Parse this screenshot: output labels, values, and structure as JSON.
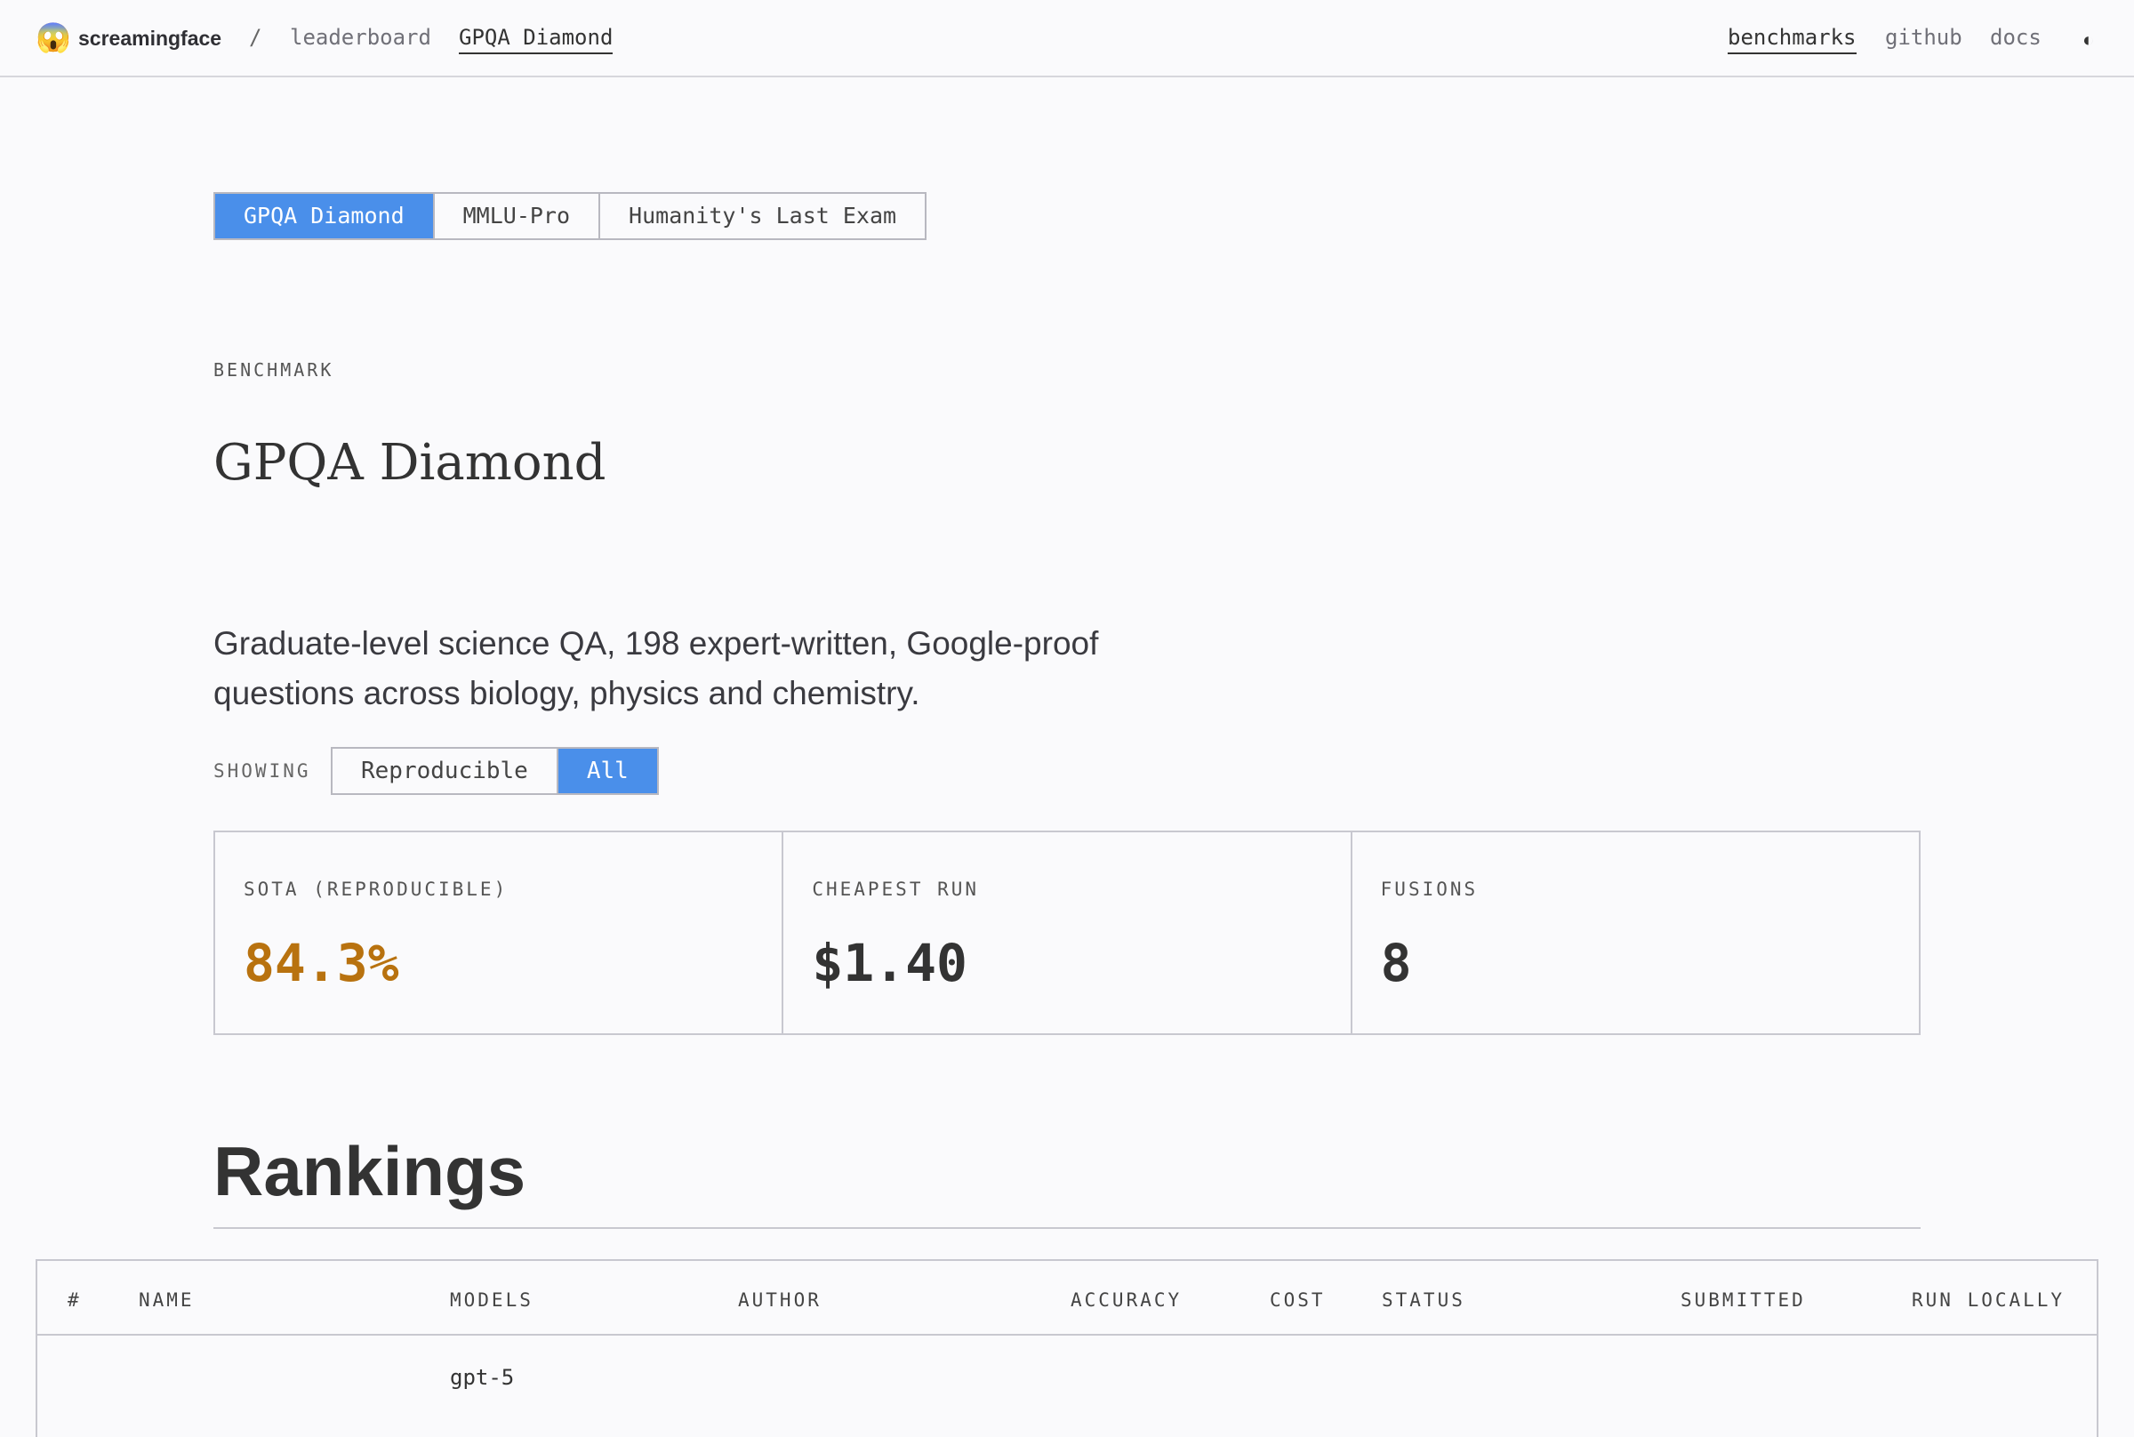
{
  "topbar": {
    "brand_emoji": "😱",
    "brand_name": "screamingface",
    "breadcrumb_sep": "/",
    "breadcrumb_leaderboard": "leaderboard",
    "breadcrumb_current": "GPQA Diamond",
    "nav_benchmarks": "benchmarks",
    "nav_github": "github",
    "nav_docs": "docs",
    "theme_icon": "◐"
  },
  "benchmark_tabs": [
    {
      "label": "GPQA Diamond",
      "active": true
    },
    {
      "label": "MMLU-Pro",
      "active": false
    },
    {
      "label": "Humanity's Last Exam",
      "active": false
    }
  ],
  "benchmark": {
    "section_label": "BENCHMARK",
    "title": "GPQA Diamond",
    "description": "Graduate-level science QA, 198 expert-written, Google-proof questions across biology, physics and chemistry."
  },
  "filter": {
    "label": "SHOWING",
    "options": [
      {
        "label": "Reproducible",
        "active": false
      },
      {
        "label": "All",
        "active": true
      }
    ]
  },
  "stats": [
    {
      "label": "SOTA (REPRODUCIBLE)",
      "value": "84.3%",
      "accent": "#b8720f"
    },
    {
      "label": "CHEAPEST RUN",
      "value": "$1.40"
    },
    {
      "label": "FUSIONS",
      "value": "8"
    }
  ],
  "rankings": {
    "title": "Rankings",
    "columns": [
      "#",
      "NAME",
      "MODELS",
      "AUTHOR",
      "ACCURACY",
      "COST",
      "STATUS",
      "SUBMITTED",
      "RUN LOCALLY"
    ],
    "first_row_models": "gpt-5"
  },
  "colors": {
    "accent": "#4a8fea",
    "sota": "#b8720f",
    "background": "#fafafc"
  }
}
